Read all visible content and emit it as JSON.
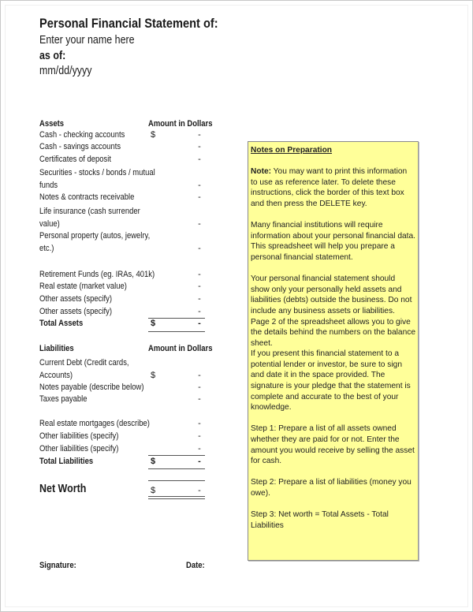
{
  "header": {
    "title": "Personal Financial Statement of:",
    "name_placeholder": "Enter your name here",
    "as_of_label": "as of:",
    "date_placeholder": "mm/dd/yyyy"
  },
  "assets": {
    "heading": "Assets",
    "amount_heading": "Amount in Dollars",
    "currency": "$",
    "rows": [
      {
        "label": "Cash - checking accounts",
        "value": "-"
      },
      {
        "label": "Cash - savings accounts",
        "value": "-"
      },
      {
        "label": "Certificates of deposit",
        "value": "-"
      },
      {
        "label": "Securities - stocks / bonds / mutual",
        "label2": "funds",
        "value": "-"
      },
      {
        "label": "Notes & contracts receivable",
        "value": "-"
      },
      {
        "label": "Life insurance (cash surrender",
        "label2": "value)",
        "value": "-"
      },
      {
        "label": "Personal property (autos, jewelry,",
        "label2": "etc.)",
        "value": "-"
      },
      {
        "label": "Retirement Funds (eg. IRAs, 401k)",
        "value": "-"
      },
      {
        "label": "Real estate (market value)",
        "value": "-"
      },
      {
        "label": "Other assets (specify)",
        "value": "-"
      },
      {
        "label": "Other assets (specify)",
        "value": "-"
      }
    ],
    "total_label": "Total Assets",
    "total_value": "-"
  },
  "liabilities": {
    "heading": "Liabilities",
    "amount_heading": "Amount in Dollars",
    "currency": "$",
    "rows": [
      {
        "label": "Current Debt (Credit cards,",
        "label2": "Accounts)",
        "value": "-"
      },
      {
        "label": "Notes payable (describe below)",
        "value": "-"
      },
      {
        "label": "Taxes payable",
        "value": "-"
      },
      {
        "label": "Real estate mortgages (describe)",
        "value": "-"
      },
      {
        "label": "Other liabilities (specify)",
        "value": "-"
      },
      {
        "label": "Other liabilities (specify)",
        "value": "-"
      }
    ],
    "total_label": "Total Liabilities",
    "total_value": "-"
  },
  "net_worth": {
    "label": "Net Worth",
    "currency": "$",
    "value": "-"
  },
  "footer": {
    "signature_label": "Signature:",
    "date_label": "Date:"
  },
  "notes": {
    "title": "Notes on Preparation",
    "note_label": "Note:",
    "note_text": " You may want to print this information to use as reference later. To delete these instructions, click the border of this text box and then press the DELETE key.",
    "p1": "Many financial institutions will require information about your personal financial data. This spreadsheet will help you prepare a personal financial statement.",
    "p2": "Your personal financial statement should show only your personally held assets and liabilities (debts) outside the business. Do not include any business assets or liabilities.",
    "p3": "Page 2 of the spreadsheet allows you to give the details behind the numbers on the balance sheet.",
    "p4": "If you present this financial statement to a potential lender or investor, be sure to sign and date it in the space provided. The signature is your pledge that the statement is complete and accurate to the best of your knowledge.",
    "step1": "Step 1: Prepare a list of all assets owned whether they are paid for or not. Enter the amount you would receive by selling the asset for cash.",
    "step2": "Step 2: Prepare a list of liabilities (money you owe).",
    "step3": "Step 3: Net worth = Total Assets - Total Liabilities"
  }
}
